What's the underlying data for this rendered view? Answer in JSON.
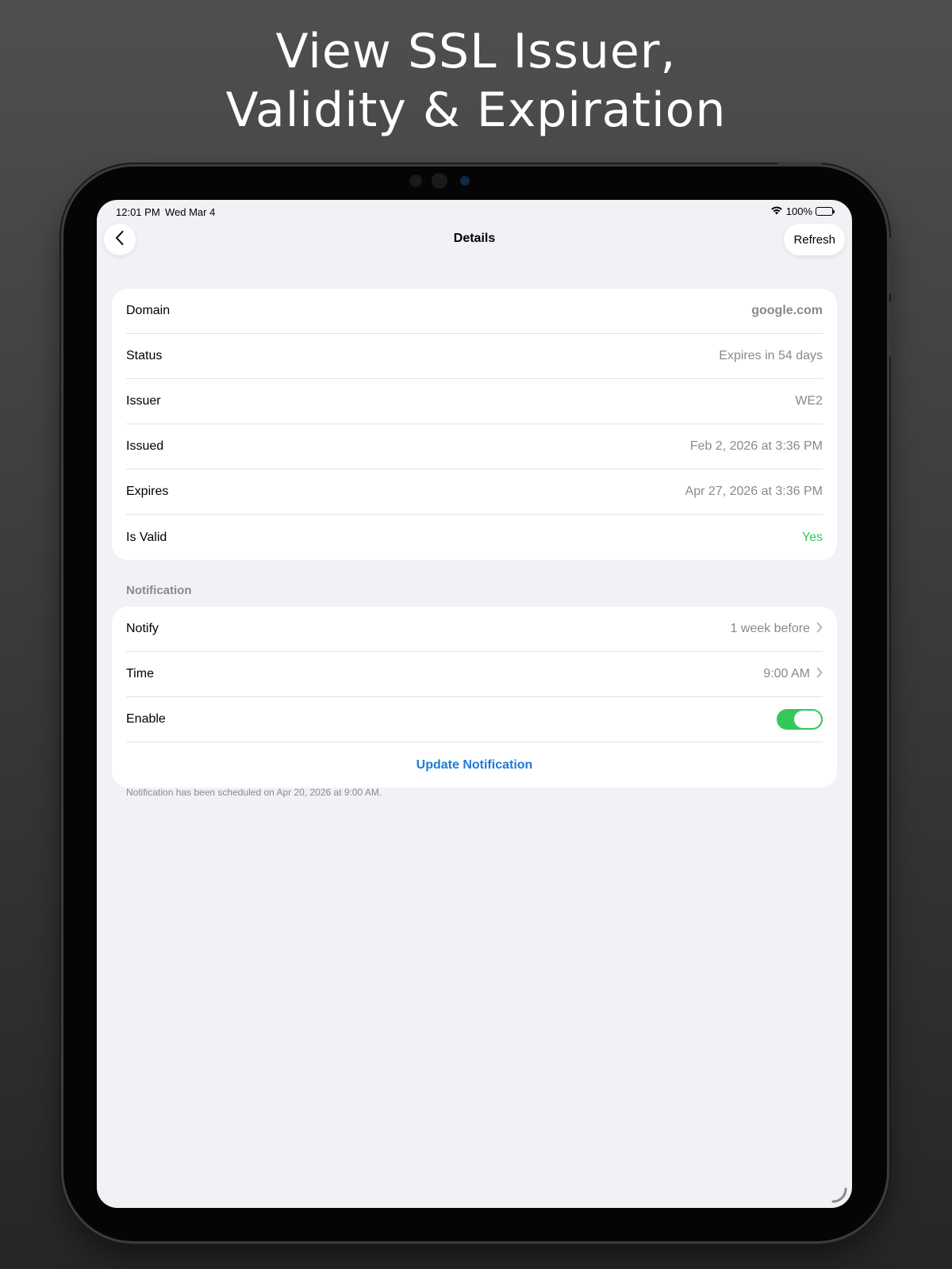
{
  "marketing": {
    "headline_line1": "View SSL Issuer,",
    "headline_line2": "Validity & Expiration"
  },
  "status_bar": {
    "time": "12:01 PM",
    "date": "Wed Mar 4",
    "battery": "100%"
  },
  "nav": {
    "title": "Details",
    "refresh_label": "Refresh"
  },
  "details": {
    "rows": [
      {
        "label": "Domain",
        "value": "google.com"
      },
      {
        "label": "Status",
        "value": "Expires in 54 days"
      },
      {
        "label": "Issuer",
        "value": "WE2"
      },
      {
        "label": "Issued",
        "value": "Feb 2, 2026 at 3:36 PM"
      },
      {
        "label": "Expires",
        "value": "Apr 27, 2026 at 3:36 PM"
      },
      {
        "label": "Is Valid",
        "value": "Yes"
      }
    ]
  },
  "notification": {
    "header": "Notification",
    "notify_label": "Notify",
    "notify_value": "1 week before",
    "time_label": "Time",
    "time_value": "9:00 AM",
    "enable_label": "Enable",
    "enabled": true,
    "update_label": "Update Notification",
    "footnote": "Notification has been scheduled on Apr 20, 2026 at 9:00 AM."
  },
  "colors": {
    "accent": "#1e7ad8",
    "valid_green": "#34c759",
    "toggle_on": "#34c759"
  }
}
